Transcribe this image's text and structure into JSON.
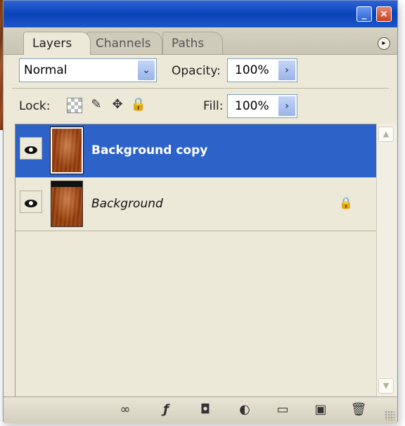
{
  "window": {
    "minimize_icon": "_",
    "close_icon": "×"
  },
  "tabs": [
    {
      "label": "Layers",
      "active": true
    },
    {
      "label": "Channels",
      "active": false
    },
    {
      "label": "Paths",
      "active": false
    }
  ],
  "panel_menu_icon": "▸",
  "blend_mode": {
    "value": "Normal",
    "arrow": "⌄"
  },
  "opacity": {
    "label": "Opacity:",
    "value": "100%",
    "arrow": "›"
  },
  "lock": {
    "label": "Lock:",
    "icons": [
      "transparent-pixels",
      "brush",
      "move",
      "padlock"
    ]
  },
  "fill": {
    "label": "Fill:",
    "value": "100%",
    "arrow": "›"
  },
  "layers": [
    {
      "name": "Background copy",
      "visible": true,
      "selected": true,
      "locked": false
    },
    {
      "name": "Background",
      "visible": true,
      "selected": false,
      "locked": true
    }
  ],
  "row_lock_icon": "🔒",
  "scroll": {
    "up": "▲",
    "down": "▼"
  },
  "toolbar": {
    "link": "∞",
    "styles": "ƒ",
    "mask": "◘",
    "adjust": "◐",
    "group": "▭",
    "new": "▣",
    "trash": "🗑"
  },
  "colors": {
    "selection": "#2d63c8",
    "titlebar": "#0a44b8",
    "panel": "#ece9d8"
  }
}
